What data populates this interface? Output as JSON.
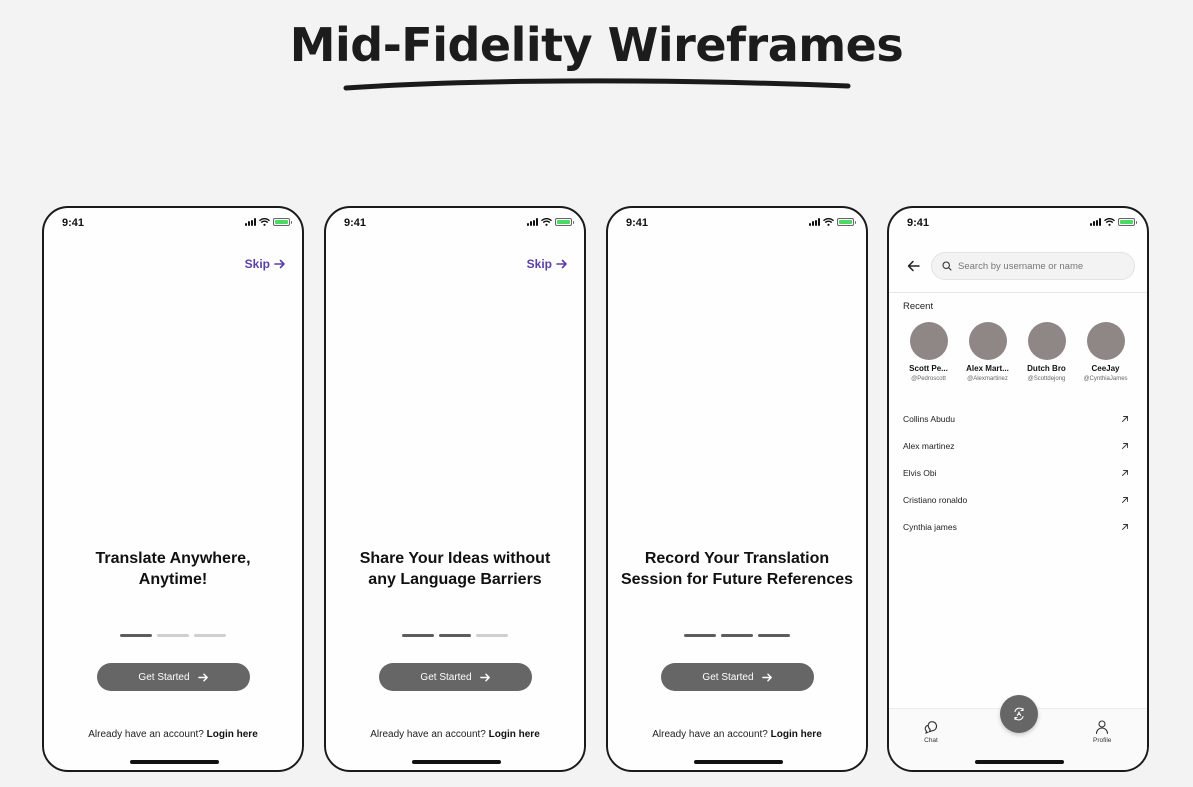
{
  "page": {
    "title": "Mid-Fidelity Wireframes"
  },
  "status": {
    "time": "9:41"
  },
  "onboarding": {
    "skip_label": "Skip",
    "cta_label": "Get Started",
    "login_prompt": "Already have an account?",
    "login_link": "Login here",
    "screens": [
      {
        "headline_line1": "Translate Anywhere,",
        "headline_line2": "Anytime!",
        "active_step": 1
      },
      {
        "headline_line1": "Share Your Ideas without",
        "headline_line2": "any Language Barriers",
        "active_step": 2
      },
      {
        "headline_line1": "Record Your Translation",
        "headline_line2": "Session for Future References",
        "active_step": 3
      }
    ]
  },
  "search_screen": {
    "search_placeholder": "Search by username or name",
    "recent_label": "Recent",
    "recent": [
      {
        "name": "Scott Pe...",
        "handle": "@Pedroscott"
      },
      {
        "name": "Alex Mart...",
        "handle": "@Alexmartinez"
      },
      {
        "name": "Dutch Bro",
        "handle": "@Scottdejong"
      },
      {
        "name": "CeeJay",
        "handle": "@CynthiaJames"
      }
    ],
    "results": [
      "Collins Abudu",
      "Alex martinez",
      "Elvis Obi",
      "Cristiano ronaldo",
      "Cynthia james"
    ],
    "nav": {
      "chat_label": "Chat",
      "profile_label": "Profile"
    }
  },
  "colors": {
    "accent": "#5b3fa6",
    "button": "#666666",
    "avatar": "#8f8686",
    "battery": "#4cd964"
  }
}
